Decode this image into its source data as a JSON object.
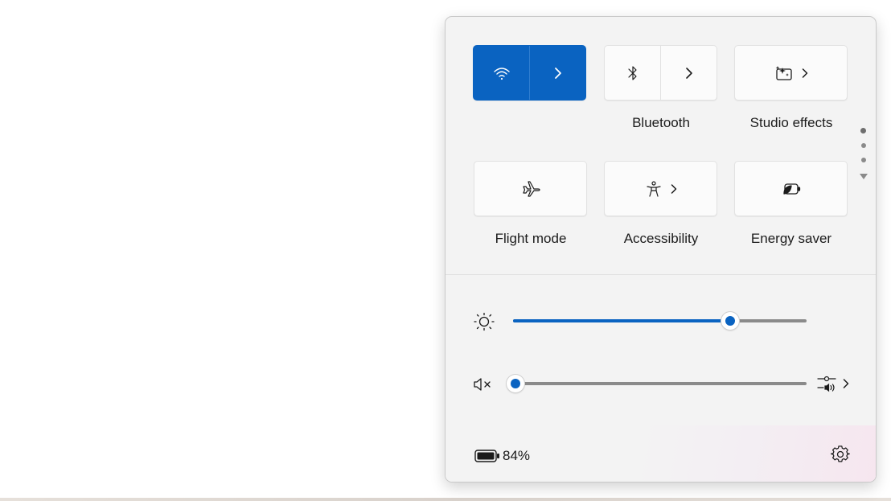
{
  "tiles": [
    {
      "id": "wifi",
      "label": "",
      "icon": "wifi-icon",
      "active": true,
      "split": true
    },
    {
      "id": "bluetooth",
      "label": "Bluetooth",
      "icon": "bluetooth-icon",
      "active": false,
      "split": true
    },
    {
      "id": "studio",
      "label": "Studio effects",
      "icon": "studio-effects-icon",
      "active": false,
      "split": false,
      "chevron": true
    },
    {
      "id": "flight",
      "label": "Flight mode",
      "icon": "airplane-icon",
      "active": false
    },
    {
      "id": "accessibility",
      "label": "Accessibility",
      "icon": "accessibility-icon",
      "active": false,
      "chevron": true
    },
    {
      "id": "energy",
      "label": "Energy saver",
      "icon": "energy-saver-icon",
      "active": false
    }
  ],
  "brightness": {
    "icon": "brightness-icon",
    "level_percent": 74
  },
  "volume": {
    "icon": "volume-muted-icon",
    "level_percent": 0,
    "output_icon": "audio-output-icon"
  },
  "pager": {
    "pages": 3,
    "current": 1
  },
  "footer": {
    "battery_icon": "battery-icon",
    "battery_text": "84%",
    "settings_icon": "gear-icon"
  },
  "colors": {
    "accent": "#0a63c1",
    "panel_bg": "#f3f3f3",
    "tile_bg": "#fbfbfb",
    "text": "#1b1b1b"
  }
}
